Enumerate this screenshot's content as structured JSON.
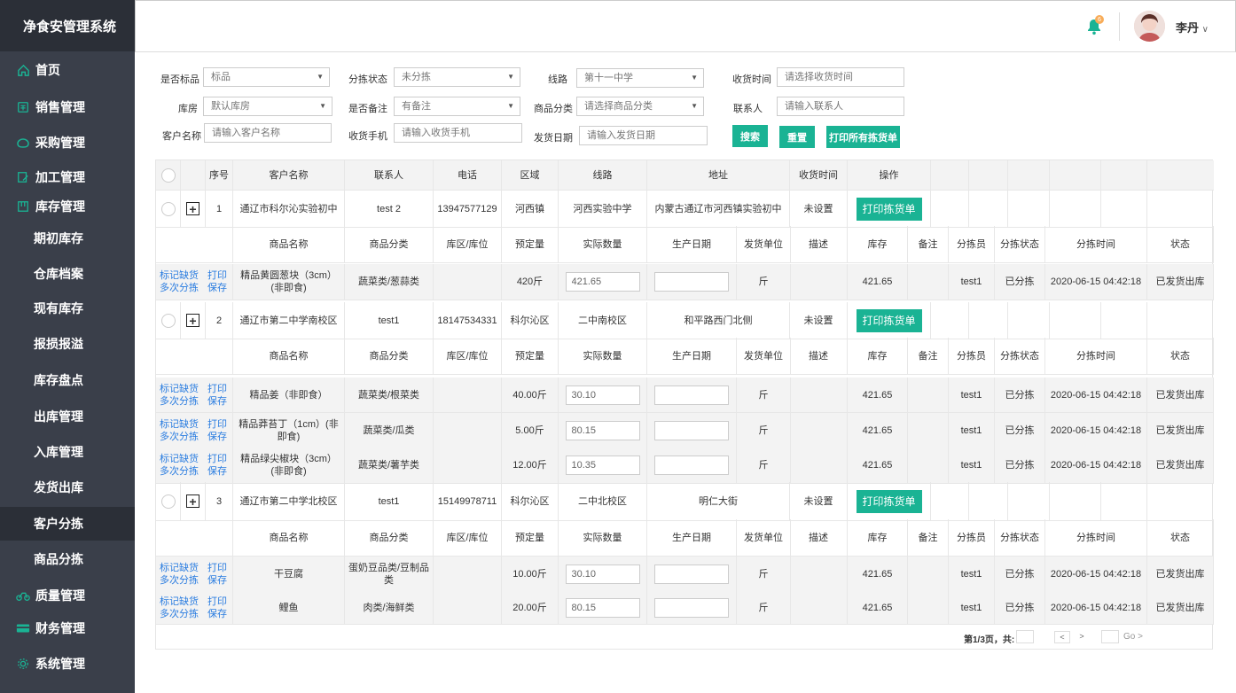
{
  "app": {
    "title": "净食安管理系统"
  },
  "sidebar": {
    "items": [
      {
        "label": "首页",
        "icon": "home-icon",
        "level": "top"
      },
      {
        "label": "销售管理",
        "icon": "sales-icon",
        "level": "top"
      },
      {
        "label": "采购管理",
        "icon": "purchase-icon",
        "level": "top"
      },
      {
        "label": "加工管理",
        "icon": "process-icon",
        "level": "top"
      },
      {
        "label": "库存管理",
        "icon": "inventory-icon",
        "level": "top"
      },
      {
        "label": "期初库存",
        "level": "sub"
      },
      {
        "label": "仓库档案",
        "level": "sub"
      },
      {
        "label": "现有库存",
        "level": "sub"
      },
      {
        "label": "报损报溢",
        "level": "sub"
      },
      {
        "label": "库存盘点",
        "level": "sub"
      },
      {
        "label": "出库管理",
        "level": "sub"
      },
      {
        "label": "入库管理",
        "level": "sub"
      },
      {
        "label": "发货出库",
        "level": "sub"
      },
      {
        "label": "客户分拣",
        "level": "sub",
        "active": true
      },
      {
        "label": "商品分拣",
        "level": "sub"
      },
      {
        "label": "质量管理",
        "icon": "quality-icon",
        "level": "top"
      },
      {
        "label": "财务管理",
        "icon": "finance-icon",
        "level": "top"
      },
      {
        "label": "系统管理",
        "icon": "settings-icon",
        "level": "top"
      }
    ]
  },
  "header": {
    "badge": "6",
    "user": "李丹",
    "chevron": "∨"
  },
  "filters": {
    "f1_label": "是否标品",
    "f1_value": "标品",
    "f2_label": "分拣状态",
    "f2_value": "未分拣",
    "f3_label": "线路",
    "f3_value": "第十一中学",
    "f4_label": "收货时间",
    "f4_ph": "请选择收货时间",
    "f5_label": "库房",
    "f5_value": "默认库房",
    "f6_label": "是否备注",
    "f6_value": "有备注",
    "f7_label": "商品分类",
    "f7_value": "请选择商品分类",
    "f8_label": "联系人",
    "f8_ph": "请输入联系人",
    "f9_label": "客户名称",
    "f9_ph": "请输入客户名称",
    "f10_label": "收货手机",
    "f10_ph": "请输入收货手机",
    "f11_label": "发货日期",
    "f11_ph": "请输入发货日期",
    "search": "搜索",
    "reset": "重置",
    "print_all": "打印所有拣货单"
  },
  "table": {
    "headers": [
      "序号",
      "客户名称",
      "联系人",
      "电话",
      "区域",
      "线路",
      "地址",
      "收货时间",
      "操作"
    ],
    "sub_headers": [
      "商品名称",
      "商品分类",
      "库区/库位",
      "预定量",
      "实际数量",
      "生产日期",
      "发货单位",
      "描述",
      "库存",
      "备注",
      "分拣员",
      "分拣状态",
      "分拣时间",
      "状态"
    ],
    "print_btn": "打印拣货单",
    "link_mark": "标记缺货",
    "link_print": "打印",
    "link_multi": "多次分拣",
    "link_save": "保存",
    "orders": [
      {
        "no": "1",
        "customer": "通辽市科尔沁实验初中",
        "contact": "test 2",
        "phone": "13947577129",
        "area": "河西镇",
        "route": "河西实验中学",
        "address": "内蒙古通辽市河西镇实验初中",
        "time": "未设置",
        "items": [
          {
            "name": "精品黄圆葱块（3cm）(非即食)",
            "cat": "蔬菜类/葱蒜类",
            "loc": "",
            "qty": "420斤",
            "actual": "421.65",
            "unit": "斤",
            "desc": "",
            "stock": "421.65",
            "note": "",
            "picker": "test1",
            "pstatus": "已分拣",
            "ptime": "2020-06-15 04:42:18",
            "status": "已发货出库"
          }
        ]
      },
      {
        "no": "2",
        "customer": "通辽市第二中学南校区",
        "contact": "test1",
        "phone": "18147534331",
        "area": "科尔沁区",
        "route": "二中南校区",
        "address": "和平路西门北侧",
        "time": "未设置",
        "items": [
          {
            "name": "精品姜（非即食）",
            "cat": "蔬菜类/根菜类",
            "loc": "",
            "qty": "40.00斤",
            "actual": "30.10",
            "unit": "斤",
            "desc": "",
            "stock": "421.65",
            "note": "",
            "picker": "test1",
            "pstatus": "已分拣",
            "ptime": "2020-06-15 04:42:18",
            "status": "已发货出库"
          },
          {
            "name": "精品莽苔丁（1cm）(非即食)",
            "cat": "蔬菜类/瓜类",
            "loc": "",
            "qty": "5.00斤",
            "actual": "80.15",
            "unit": "斤",
            "desc": "",
            "stock": "421.65",
            "note": "",
            "picker": "test1",
            "pstatus": "已分拣",
            "ptime": "2020-06-15 04:42:18",
            "status": "已发货出库"
          },
          {
            "name": "精品绿尖椒块（3cm）(非即食)",
            "cat": "蔬菜类/薯芋类",
            "loc": "",
            "qty": "12.00斤",
            "actual": "10.35",
            "unit": "斤",
            "desc": "",
            "stock": "421.65",
            "note": "",
            "picker": "test1",
            "pstatus": "已分拣",
            "ptime": "2020-06-15 04:42:18",
            "status": "已发货出库"
          }
        ]
      },
      {
        "no": "3",
        "customer": "通辽市第二中学北校区",
        "contact": "test1",
        "phone": "15149978711",
        "area": "科尔沁区",
        "route": "二中北校区",
        "address": "明仁大街",
        "time": "未设置",
        "items": [
          {
            "name": "干豆腐",
            "cat": "蛋奶豆品类/豆制品类",
            "loc": "",
            "qty": "10.00斤",
            "actual": "30.10",
            "unit": "斤",
            "desc": "",
            "stock": "421.65",
            "note": "",
            "picker": "test1",
            "pstatus": "已分拣",
            "ptime": "2020-06-15 04:42:18",
            "status": "已发货出库"
          },
          {
            "name": "鲤鱼",
            "cat": "肉类/海鲜类",
            "loc": "",
            "qty": "20.00斤",
            "actual": "80.15",
            "unit": "斤",
            "desc": "",
            "stock": "421.65",
            "note": "",
            "picker": "test1",
            "pstatus": "已分拣",
            "ptime": "2020-06-15 04:42:18",
            "status": "已发货出库"
          }
        ]
      }
    ]
  },
  "pager": {
    "text": "第1/3页，共:",
    "prev": "<",
    "next": ">",
    "go": "Go >"
  },
  "colors": {
    "accent": "#1ab394",
    "sidebar": "#3a3f4a",
    "sidebar_dark": "#2b2f37",
    "link": "#2b7de0"
  }
}
